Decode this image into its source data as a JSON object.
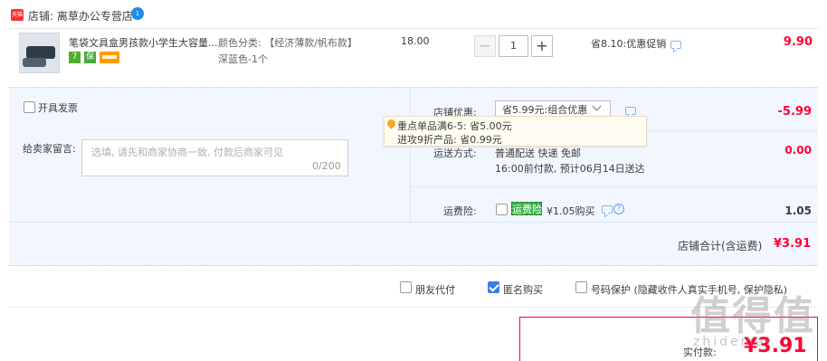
{
  "shop": {
    "tag_icon": "tmall-shop-icon",
    "tag_text": "天猫",
    "name": "店铺: 离草办公专营店",
    "badge_text": "1"
  },
  "item": {
    "title": "笔袋文具盒男孩款小学生大容量...",
    "service_icon_1": "7",
    "service_icon_2": "保",
    "spec_line_1": "颜色分类: 【经济薄款/帆布款】",
    "spec_line_2": "深蓝色-1个",
    "unit_price": "18.00",
    "qty_minus": "−",
    "quantity": "1",
    "qty_plus": "+",
    "promo": "省8.10:优惠促销",
    "total": "9.90"
  },
  "invoice": {
    "label": "开具发票",
    "checked": false
  },
  "message": {
    "label": "给卖家留言:",
    "placeholder": "选填, 请先和商家协商一致, 付款后商家可见",
    "counter": "0/200"
  },
  "shop_discount": {
    "label": "店铺优惠:",
    "selected": "省5.99元:组合优惠",
    "amount": "-5.99",
    "tooltip_line_1": "重点单品满6-5: 省5.00元",
    "tooltip_line_2": "进攻9折产品: 省0.99元"
  },
  "shipping": {
    "label": "运送方式:",
    "method": "普通配送 快递 免邮",
    "eta": "16:00前付款, 预计06月14日送达",
    "amount": "0.00"
  },
  "shipping_insurance": {
    "label": "运费险:",
    "tag": "运费险",
    "price_text": "¥1.05购买",
    "amount": "1.05",
    "checked": false
  },
  "shop_total": {
    "label": "店铺合计(含运费)",
    "amount": "¥3.91"
  },
  "options": {
    "friend_pay": {
      "label": "朋友代付",
      "checked": false
    },
    "anonymous": {
      "label": "匿名购买",
      "checked": true
    },
    "number_protect": {
      "label": "号码保护 (隐藏收件人真实手机号, 保护隐私)",
      "checked": false
    }
  },
  "pay": {
    "label": "实付款:",
    "amount": "¥3.91"
  },
  "watermark": {
    "big": "值得值",
    "small": "zhidemai"
  },
  "colors": {
    "accent_red": "#ff0036",
    "panel_bg": "#f2f7ff",
    "check_blue": "#3d7ee6"
  }
}
